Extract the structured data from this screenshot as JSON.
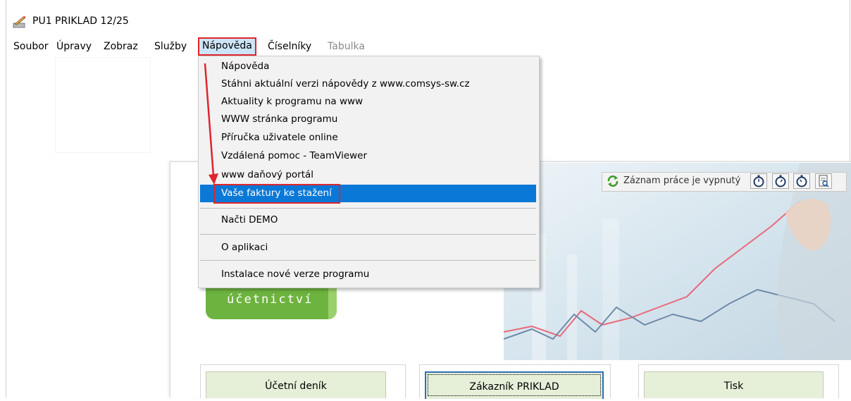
{
  "window": {
    "title": "PU1 PRIKLAD 12/25"
  },
  "menubar": {
    "items": [
      {
        "label": "Soubor"
      },
      {
        "label": "Úpravy"
      },
      {
        "label": "Zobraz"
      },
      {
        "label": "Služby"
      },
      {
        "label": "Nápověda"
      },
      {
        "label": "Číselníky"
      },
      {
        "label": "Tabulka"
      }
    ]
  },
  "dropdown": {
    "items": [
      "Nápověda",
      "Stáhni aktuální verzi nápovědy z www.comsys-sw.cz",
      "Aktuality k programu na www",
      "WWW stránka programu",
      "Příručka uživatele online",
      "Vzdálená pomoc - TeamViewer",
      "www daňový portál",
      "Vaše faktury ke stažení",
      "Načti DEMO",
      "O aplikaci",
      "Instalace nové verze programu"
    ]
  },
  "statusbar": {
    "text": "Záznam práce je vypnutý"
  },
  "logo": {
    "text": "účetnictví"
  },
  "bottom": {
    "buttons": [
      {
        "label": "Účetní deník"
      },
      {
        "label": "Zákazník  PRIKLAD"
      },
      {
        "label": "Tisk"
      }
    ]
  },
  "colors": {
    "highlight": "#0a78d7",
    "annotation_red": "#e0252b",
    "logo_green": "#6db33f",
    "button_green": "#e6efd8"
  }
}
